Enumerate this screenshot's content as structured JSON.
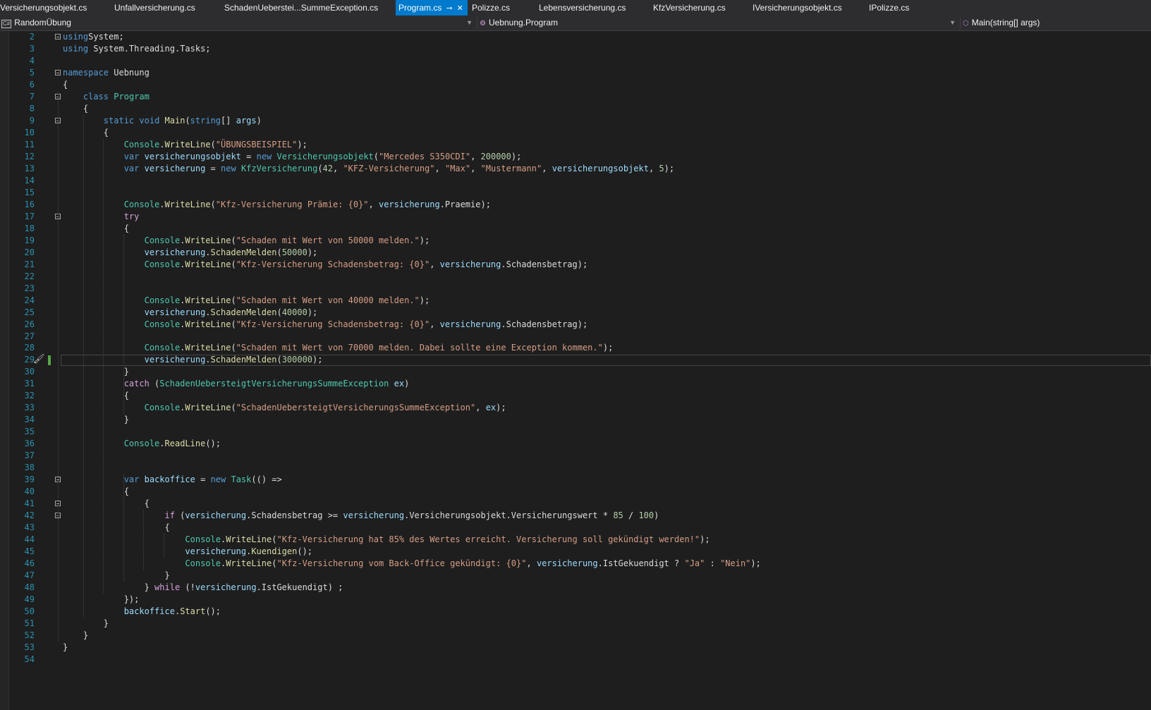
{
  "tabs": [
    {
      "label": "Versicherungsobjekt.cs",
      "active": false
    },
    {
      "label": "Unfallversicherung.cs",
      "active": false
    },
    {
      "label": "SchadenUeberstei...SummeException.cs",
      "active": false
    },
    {
      "label": "Program.cs",
      "active": true
    },
    {
      "label": "Polizze.cs",
      "active": false
    },
    {
      "label": "Lebensversicherung.cs",
      "active": false
    },
    {
      "label": "KfzVersicherung.cs",
      "active": false
    },
    {
      "label": "IVersicherungsobjekt.cs",
      "active": false
    },
    {
      "label": "IPolizze.cs",
      "active": false
    }
  ],
  "active_tab": {
    "pin_glyph": "⊸",
    "close_glyph": "✕"
  },
  "navbar": {
    "project": "RandomÜbung",
    "project_icon": "C#",
    "class": "Uebnung.Program",
    "member": "Main(string[] args)"
  },
  "editor": {
    "current_line": 29,
    "colors": {
      "keyword": "#569cd6",
      "control": "#d8a0df",
      "type": "#4ec9b0",
      "string": "#d69d85",
      "number": "#b5cea8",
      "method": "#dcdcaa",
      "variable": "#9cdcfe",
      "line_number": "#2b91af"
    },
    "lines": [
      {
        "n": "2",
        "tokens": [
          [
            "kw",
            "using"
          ],
          [
            "",
            "System;"
          ]
        ]
      },
      {
        "n": "3",
        "tokens": [
          [
            "kw",
            "using"
          ],
          [
            "",
            " System.Threading.Tasks;"
          ]
        ]
      },
      {
        "n": "4",
        "tokens": []
      },
      {
        "n": "5",
        "tokens": [
          [
            "kw",
            "namespace"
          ],
          [
            "",
            " Uebnung"
          ]
        ]
      },
      {
        "n": "6",
        "tokens": [
          [
            "",
            "{"
          ]
        ]
      },
      {
        "n": "7",
        "tokens": [
          [
            "",
            "    "
          ],
          [
            "kw",
            "class"
          ],
          [
            "",
            " "
          ],
          [
            "ty",
            "Program"
          ]
        ]
      },
      {
        "n": "8",
        "tokens": [
          [
            "",
            "    {"
          ]
        ]
      },
      {
        "n": "9",
        "tokens": [
          [
            "",
            "        "
          ],
          [
            "kw",
            "static"
          ],
          [
            "",
            " "
          ],
          [
            "kw",
            "void"
          ],
          [
            "",
            " "
          ],
          [
            "fn",
            "Main"
          ],
          [
            "",
            "("
          ],
          [
            "kw",
            "string"
          ],
          [
            "",
            "[] "
          ],
          [
            "vr",
            "args"
          ],
          [
            "",
            ")"
          ]
        ]
      },
      {
        "n": "10",
        "tokens": [
          [
            "",
            "        {"
          ]
        ]
      },
      {
        "n": "11",
        "tokens": [
          [
            "",
            "            "
          ],
          [
            "ty",
            "Console"
          ],
          [
            "",
            "."
          ],
          [
            "fn",
            "WriteLine"
          ],
          [
            "",
            "("
          ],
          [
            "st",
            "\"ÜBUNGSBEISPIEL\""
          ],
          [
            "",
            ");"
          ]
        ]
      },
      {
        "n": "12",
        "tokens": [
          [
            "",
            "            "
          ],
          [
            "kw",
            "var"
          ],
          [
            "",
            " "
          ],
          [
            "vr",
            "versicherungsobjekt"
          ],
          [
            "",
            " = "
          ],
          [
            "kw",
            "new"
          ],
          [
            "",
            " "
          ],
          [
            "ty",
            "Versicherungsobjekt"
          ],
          [
            "",
            "("
          ],
          [
            "st",
            "\"Mercedes S350CDI\""
          ],
          [
            "",
            ", "
          ],
          [
            "nm",
            "200000"
          ],
          [
            "",
            ");"
          ]
        ]
      },
      {
        "n": "13",
        "tokens": [
          [
            "",
            "            "
          ],
          [
            "kw",
            "var"
          ],
          [
            "",
            " "
          ],
          [
            "vr",
            "versicherung"
          ],
          [
            "",
            " = "
          ],
          [
            "kw",
            "new"
          ],
          [
            "",
            " "
          ],
          [
            "ty",
            "KfzVersicherung"
          ],
          [
            "",
            "("
          ],
          [
            "nm",
            "42"
          ],
          [
            "",
            ", "
          ],
          [
            "st",
            "\"KFZ-Versicherung\""
          ],
          [
            "",
            ", "
          ],
          [
            "st",
            "\"Max\""
          ],
          [
            "",
            ", "
          ],
          [
            "st",
            "\"Mustermann\""
          ],
          [
            "",
            ", "
          ],
          [
            "vr",
            "versicherungsobjekt"
          ],
          [
            "",
            ", "
          ],
          [
            "nm",
            "5"
          ],
          [
            "",
            ");"
          ]
        ]
      },
      {
        "n": "14",
        "tokens": []
      },
      {
        "n": "15",
        "tokens": []
      },
      {
        "n": "16",
        "tokens": [
          [
            "",
            "            "
          ],
          [
            "ty",
            "Console"
          ],
          [
            "",
            "."
          ],
          [
            "fn",
            "WriteLine"
          ],
          [
            "",
            "("
          ],
          [
            "st",
            "\"Kfz-Versicherung Prämie: {0}\""
          ],
          [
            "",
            ", "
          ],
          [
            "vr",
            "versicherung"
          ],
          [
            "",
            ".Praemie);"
          ]
        ]
      },
      {
        "n": "17",
        "tokens": [
          [
            "",
            "            "
          ],
          [
            "kwc",
            "try"
          ]
        ]
      },
      {
        "n": "18",
        "tokens": [
          [
            "",
            "            {"
          ]
        ]
      },
      {
        "n": "19",
        "tokens": [
          [
            "",
            "                "
          ],
          [
            "ty",
            "Console"
          ],
          [
            "",
            "."
          ],
          [
            "fn",
            "WriteLine"
          ],
          [
            "",
            "("
          ],
          [
            "st",
            "\"Schaden mit Wert von 50000 melden.\""
          ],
          [
            "",
            ");"
          ]
        ]
      },
      {
        "n": "20",
        "tokens": [
          [
            "",
            "                "
          ],
          [
            "vr",
            "versicherung"
          ],
          [
            "",
            "."
          ],
          [
            "fn",
            "SchadenMelden"
          ],
          [
            "",
            "("
          ],
          [
            "nm",
            "50000"
          ],
          [
            "",
            ");"
          ]
        ]
      },
      {
        "n": "21",
        "tokens": [
          [
            "",
            "                "
          ],
          [
            "ty",
            "Console"
          ],
          [
            "",
            "."
          ],
          [
            "fn",
            "WriteLine"
          ],
          [
            "",
            "("
          ],
          [
            "st",
            "\"Kfz-Versicherung Schadensbetrag: {0}\""
          ],
          [
            "",
            ", "
          ],
          [
            "vr",
            "versicherung"
          ],
          [
            "",
            ".Schadensbetrag);"
          ]
        ]
      },
      {
        "n": "22",
        "tokens": []
      },
      {
        "n": "23",
        "tokens": []
      },
      {
        "n": "24",
        "tokens": [
          [
            "",
            "                "
          ],
          [
            "ty",
            "Console"
          ],
          [
            "",
            "."
          ],
          [
            "fn",
            "WriteLine"
          ],
          [
            "",
            "("
          ],
          [
            "st",
            "\"Schaden mit Wert von 40000 melden.\""
          ],
          [
            "",
            ");"
          ]
        ]
      },
      {
        "n": "25",
        "tokens": [
          [
            "",
            "                "
          ],
          [
            "vr",
            "versicherung"
          ],
          [
            "",
            "."
          ],
          [
            "fn",
            "SchadenMelden"
          ],
          [
            "",
            "("
          ],
          [
            "nm",
            "40000"
          ],
          [
            "",
            ");"
          ]
        ]
      },
      {
        "n": "26",
        "tokens": [
          [
            "",
            "                "
          ],
          [
            "ty",
            "Console"
          ],
          [
            "",
            "."
          ],
          [
            "fn",
            "WriteLine"
          ],
          [
            "",
            "("
          ],
          [
            "st",
            "\"Kfz-Versicherung Schadensbetrag: {0}\""
          ],
          [
            "",
            ", "
          ],
          [
            "vr",
            "versicherung"
          ],
          [
            "",
            ".Schadensbetrag);"
          ]
        ]
      },
      {
        "n": "27",
        "tokens": []
      },
      {
        "n": "28",
        "tokens": [
          [
            "",
            "                "
          ],
          [
            "ty",
            "Console"
          ],
          [
            "",
            "."
          ],
          [
            "fn",
            "WriteLine"
          ],
          [
            "",
            "("
          ],
          [
            "st",
            "\"Schaden mit Wert von 70000 melden. Dabei sollte eine Exception kommen.\""
          ],
          [
            "",
            ");"
          ]
        ]
      },
      {
        "n": "29",
        "tokens": [
          [
            "",
            "                "
          ],
          [
            "vr",
            "versicherung"
          ],
          [
            "",
            "."
          ],
          [
            "fn",
            "SchadenMelden"
          ],
          [
            "",
            "("
          ],
          [
            "nm",
            "300000"
          ],
          [
            "",
            ");"
          ]
        ]
      },
      {
        "n": "30",
        "tokens": [
          [
            "",
            "            }"
          ]
        ]
      },
      {
        "n": "31",
        "tokens": [
          [
            "",
            "            "
          ],
          [
            "kwc",
            "catch"
          ],
          [
            "",
            " ("
          ],
          [
            "ty",
            "SchadenUebersteigtVersicherungsSummeException"
          ],
          [
            "",
            " "
          ],
          [
            "vr",
            "ex"
          ],
          [
            "",
            ")"
          ]
        ]
      },
      {
        "n": "32",
        "tokens": [
          [
            "",
            "            {"
          ]
        ]
      },
      {
        "n": "33",
        "tokens": [
          [
            "",
            "                "
          ],
          [
            "ty",
            "Console"
          ],
          [
            "",
            "."
          ],
          [
            "fn",
            "WriteLine"
          ],
          [
            "",
            "("
          ],
          [
            "st",
            "\"SchadenUebersteigtVersicherungsSummeException\""
          ],
          [
            "",
            ", "
          ],
          [
            "vr",
            "ex"
          ],
          [
            "",
            ");"
          ]
        ]
      },
      {
        "n": "34",
        "tokens": [
          [
            "",
            "            }"
          ]
        ]
      },
      {
        "n": "35",
        "tokens": []
      },
      {
        "n": "36",
        "tokens": [
          [
            "",
            "            "
          ],
          [
            "ty",
            "Console"
          ],
          [
            "",
            "."
          ],
          [
            "fn",
            "ReadLine"
          ],
          [
            "",
            "();"
          ]
        ]
      },
      {
        "n": "37",
        "tokens": []
      },
      {
        "n": "38",
        "tokens": []
      },
      {
        "n": "39",
        "tokens": [
          [
            "",
            "            "
          ],
          [
            "kw",
            "var"
          ],
          [
            "",
            " "
          ],
          [
            "vr",
            "backoffice"
          ],
          [
            "",
            " = "
          ],
          [
            "kw",
            "new"
          ],
          [
            "",
            " "
          ],
          [
            "ty",
            "Task"
          ],
          [
            "",
            "(() =>"
          ]
        ]
      },
      {
        "n": "40",
        "tokens": [
          [
            "",
            "            {"
          ]
        ]
      },
      {
        "n": "41",
        "tokens": [
          [
            "",
            "                {"
          ]
        ]
      },
      {
        "n": "42",
        "tokens": [
          [
            "",
            "                    "
          ],
          [
            "kwc",
            "if"
          ],
          [
            "",
            " ("
          ],
          [
            "vr",
            "versicherung"
          ],
          [
            "",
            ".Schadensbetrag >= "
          ],
          [
            "vr",
            "versicherung"
          ],
          [
            "",
            ".Versicherungsobjekt.Versicherungswert * "
          ],
          [
            "nm",
            "85"
          ],
          [
            "",
            " / "
          ],
          [
            "nm",
            "100"
          ],
          [
            "",
            ")"
          ]
        ]
      },
      {
        "n": "43",
        "tokens": [
          [
            "",
            "                    {"
          ]
        ]
      },
      {
        "n": "44",
        "tokens": [
          [
            "",
            "                        "
          ],
          [
            "ty",
            "Console"
          ],
          [
            "",
            "."
          ],
          [
            "fn",
            "WriteLine"
          ],
          [
            "",
            "("
          ],
          [
            "st",
            "\"Kfz-Versicherung hat 85% des Wertes erreicht. Versicherung soll gekündigt werden!\""
          ],
          [
            "",
            ");"
          ]
        ]
      },
      {
        "n": "45",
        "tokens": [
          [
            "",
            "                        "
          ],
          [
            "vr",
            "versicherung"
          ],
          [
            "",
            "."
          ],
          [
            "fn",
            "Kuendigen"
          ],
          [
            "",
            "();"
          ]
        ]
      },
      {
        "n": "46",
        "tokens": [
          [
            "",
            "                        "
          ],
          [
            "ty",
            "Console"
          ],
          [
            "",
            "."
          ],
          [
            "fn",
            "WriteLine"
          ],
          [
            "",
            "("
          ],
          [
            "st",
            "\"Kfz-Versicherung vom Back-Office gekündigt: {0}\""
          ],
          [
            "",
            ", "
          ],
          [
            "vr",
            "versicherung"
          ],
          [
            "",
            ".IstGekuendigt ? "
          ],
          [
            "st",
            "\"Ja\""
          ],
          [
            "",
            " : "
          ],
          [
            "st",
            "\"Nein\""
          ],
          [
            "",
            ");"
          ]
        ]
      },
      {
        "n": "47",
        "tokens": [
          [
            "",
            "                    }"
          ]
        ]
      },
      {
        "n": "48",
        "tokens": [
          [
            "",
            "                } "
          ],
          [
            "kwc",
            "while"
          ],
          [
            "",
            " (!"
          ],
          [
            "vr",
            "versicherung"
          ],
          [
            "",
            ".IstGekuendigt) ;"
          ]
        ]
      },
      {
        "n": "49",
        "tokens": [
          [
            "",
            "            });"
          ]
        ]
      },
      {
        "n": "50",
        "tokens": [
          [
            "",
            "            "
          ],
          [
            "vr",
            "backoffice"
          ],
          [
            "",
            "."
          ],
          [
            "fn",
            "Start"
          ],
          [
            "",
            "();"
          ]
        ]
      },
      {
        "n": "51",
        "tokens": [
          [
            "",
            "        }"
          ]
        ]
      },
      {
        "n": "52",
        "tokens": [
          [
            "",
            "    }"
          ]
        ]
      },
      {
        "n": "53",
        "tokens": [
          [
            "",
            "}"
          ]
        ]
      },
      {
        "n": "54",
        "tokens": []
      }
    ]
  }
}
